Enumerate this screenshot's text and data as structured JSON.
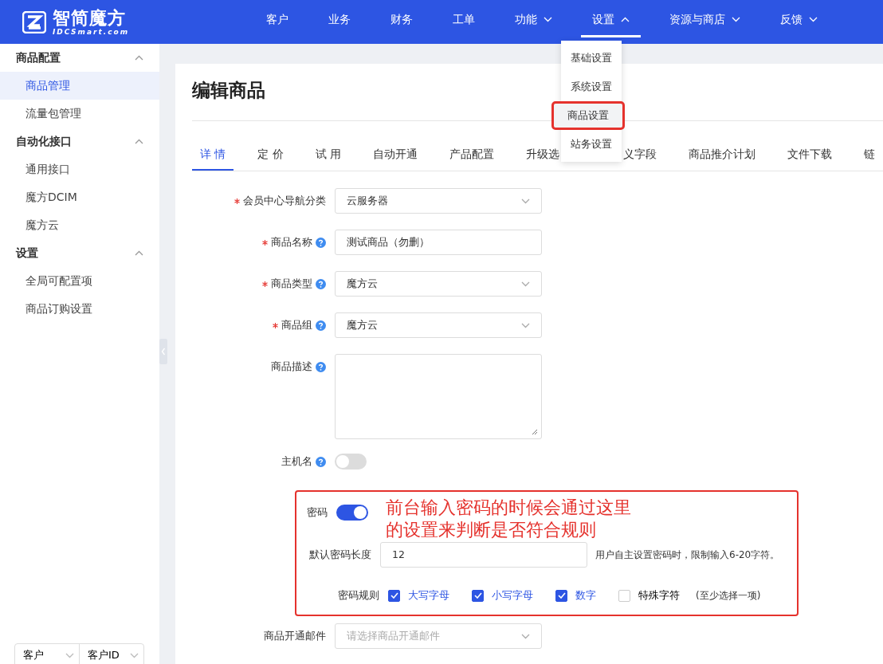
{
  "header": {
    "logo": {
      "name": "智简魔方",
      "domain": "IDCSmart.com"
    },
    "nav": [
      {
        "label": "客户",
        "has_menu": false,
        "selected": false
      },
      {
        "label": "业务",
        "has_menu": false,
        "selected": false
      },
      {
        "label": "财务",
        "has_menu": false,
        "selected": false
      },
      {
        "label": "工单",
        "has_menu": false,
        "selected": false
      },
      {
        "label": "功能",
        "has_menu": true,
        "expanded": false,
        "selected": false
      },
      {
        "label": "设置",
        "has_menu": true,
        "expanded": true,
        "selected": true
      },
      {
        "label": "资源与商店",
        "has_menu": true,
        "expanded": false,
        "selected": false
      },
      {
        "label": "反馈",
        "has_menu": true,
        "expanded": false,
        "selected": false
      }
    ],
    "menu": [
      {
        "label": "基础设置",
        "annotated": false
      },
      {
        "label": "系统设置",
        "annotated": false
      },
      {
        "label": "商品设置",
        "annotated": true
      },
      {
        "label": "站务设置",
        "annotated": false
      }
    ]
  },
  "sidebar": {
    "groups": [
      {
        "label": "商品配置",
        "expanded": true,
        "items": [
          {
            "label": "商品管理",
            "selected": true
          },
          {
            "label": "流量包管理",
            "selected": false
          }
        ]
      },
      {
        "label": "自动化接口",
        "expanded": true,
        "items": [
          {
            "label": "通用接口",
            "selected": false
          },
          {
            "label": "魔方DCIM",
            "selected": false
          },
          {
            "label": "魔方云",
            "selected": false
          }
        ]
      },
      {
        "label": "设置",
        "expanded": true,
        "items": [
          {
            "label": "全局可配置项",
            "selected": false
          },
          {
            "label": "商品订购设置",
            "selected": false
          }
        ]
      }
    ],
    "footer_selects": [
      {
        "value": "客户"
      },
      {
        "value": "客户ID"
      }
    ]
  },
  "page": {
    "title": "编辑商品",
    "tabs": [
      {
        "label": "详 情",
        "selected": true
      },
      {
        "label": "定 价",
        "selected": false
      },
      {
        "label": "试 用",
        "selected": false
      },
      {
        "label": "自动开通",
        "selected": false
      },
      {
        "label": "产品配置",
        "selected": false
      },
      {
        "label": "升级选",
        "selected": false
      },
      {
        "label": "义字段",
        "selected": false
      },
      {
        "label": "商品推介计划",
        "selected": false
      },
      {
        "label": "文件下载",
        "selected": false
      },
      {
        "label": "链",
        "selected": false
      }
    ],
    "fields": [
      {
        "kind": "select",
        "label": "会员中心导航分类",
        "required": true,
        "help": false,
        "value": "云服务器"
      },
      {
        "kind": "text",
        "label": "商品名称",
        "required": true,
        "help": true,
        "value": "测试商品（勿删）"
      },
      {
        "kind": "select",
        "label": "商品类型",
        "required": true,
        "help": true,
        "value": "魔方云"
      },
      {
        "kind": "select",
        "label": "商品组",
        "required": true,
        "help": true,
        "value": "魔方云"
      },
      {
        "kind": "textarea",
        "label": "商品描述",
        "required": false,
        "help": true
      },
      {
        "kind": "switch",
        "label": "主机名",
        "required": false,
        "help": true,
        "on": false
      }
    ],
    "password": {
      "label": "密码",
      "on": true,
      "annotation": [
        "前台输入密码的时候会通过这里",
        "的设置来判断是否符合规则"
      ],
      "length": {
        "label": "默认密码长度",
        "value": "12",
        "hint": "用户自主设置密码时，限制输入6-20字符。"
      },
      "rules": {
        "label": "密码规则",
        "options": [
          {
            "label": "大写字母",
            "checked": true
          },
          {
            "label": "小写字母",
            "checked": true
          },
          {
            "label": "数字",
            "checked": true
          },
          {
            "label": "特殊字符",
            "checked": false
          }
        ],
        "note": "(至少选择一项)"
      }
    },
    "email": {
      "label": "商品开通邮件",
      "placeholder": "请选择商品开通邮件"
    }
  }
}
